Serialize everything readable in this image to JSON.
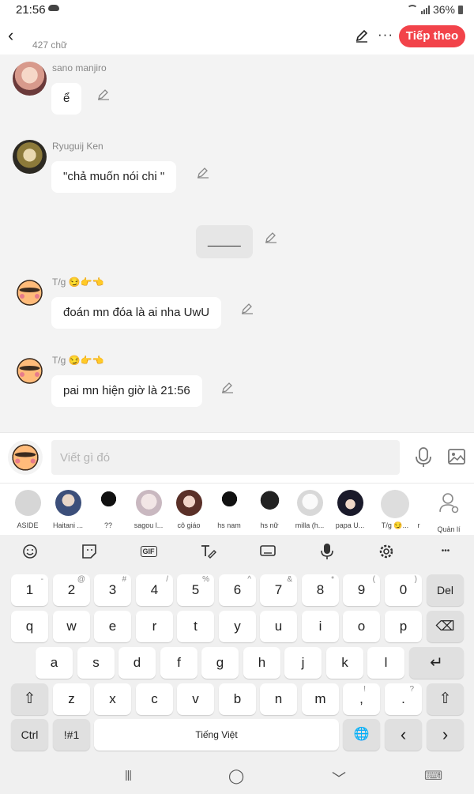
{
  "status": {
    "time": "21:56",
    "battery": "36%"
  },
  "header": {
    "back": "‹",
    "word_count": "427 chữ",
    "more": "···",
    "next_label": "Tiếp theo"
  },
  "messages": [
    {
      "name": "sano manjiro",
      "text": "ể"
    },
    {
      "name": "Ryuguij Ken",
      "text": "\"chả muốn nói chi \""
    },
    {
      "name": "",
      "text": "_____"
    },
    {
      "name": "T/g 😏👉👈",
      "text": "đoán mn đóa là ai nha UwU"
    },
    {
      "name": "T/g 😏👉👈",
      "text": "pai mn hiện giờ là 21:56"
    }
  ],
  "input": {
    "placeholder": "Viết gì đó"
  },
  "characters": [
    {
      "label": "ASIDE"
    },
    {
      "label": "Haitani ..."
    },
    {
      "label": "??"
    },
    {
      "label": "sagou l..."
    },
    {
      "label": "cô giáo"
    },
    {
      "label": "hs nam"
    },
    {
      "label": "hs nữ"
    },
    {
      "label": "milla (h..."
    },
    {
      "label": "papa U..."
    },
    {
      "label": "T/g 😏..."
    },
    {
      "label": "r"
    },
    {
      "label": "Quản lí"
    }
  ],
  "keyboard": {
    "tools": [
      "emoji-icon",
      "sticker-icon",
      "gif-icon",
      "handwriting-icon",
      "keyboard-icon",
      "mic-icon",
      "settings-icon",
      "more-icon"
    ],
    "gif": "GIF",
    "more": "•••",
    "row1": [
      {
        "k": "1",
        "s": "-"
      },
      {
        "k": "2",
        "s": "@"
      },
      {
        "k": "3",
        "s": "#"
      },
      {
        "k": "4",
        "s": "/"
      },
      {
        "k": "5",
        "s": "%"
      },
      {
        "k": "6",
        "s": "^"
      },
      {
        "k": "7",
        "s": "&"
      },
      {
        "k": "8",
        "s": "*"
      },
      {
        "k": "9",
        "s": "("
      },
      {
        "k": "0",
        "s": ")"
      }
    ],
    "del": "Del",
    "row2": [
      "q",
      "w",
      "e",
      "r",
      "t",
      "y",
      "u",
      "i",
      "o",
      "p"
    ],
    "row3": [
      "a",
      "s",
      "d",
      "f",
      "g",
      "h",
      "j",
      "k",
      "l"
    ],
    "row4": [
      "z",
      "x",
      "c",
      "v",
      "b",
      "n",
      "m"
    ],
    "comma": ",",
    "comma_sup": "!",
    "period": ".",
    "period_sup": "?",
    "ctrl": "Ctrl",
    "sym": "!#1",
    "space": "Tiếng Việt",
    "shift": "⇧",
    "enter": "↵",
    "backspace": "⌫",
    "globe": "🌐",
    "left": "‹",
    "right": "›"
  },
  "nav": {
    "recent": "|||",
    "home": "◯",
    "back": "﹀",
    "kbd": "⌨"
  }
}
